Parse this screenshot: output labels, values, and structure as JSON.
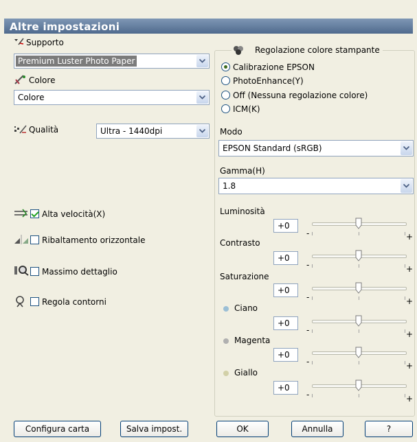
{
  "window": {
    "title": "Altre impostazioni"
  },
  "left": {
    "supporto_label": "Supporto",
    "supporto_value": "Premium Luster Photo Paper",
    "colore_label": "Colore",
    "colore_value": "Colore",
    "qualita_label": "Qualità",
    "qualita_value": "Ultra - 1440dpi",
    "alta_velocita_label": "Alta velocità(X)",
    "alta_velocita_checked": true,
    "ribaltamento_label": "Ribaltamento orizzontale",
    "ribaltamento_checked": false,
    "massimo_label": "Massimo dettaglio",
    "massimo_checked": false,
    "contorni_label": "Regola contorni",
    "contorni_checked": false
  },
  "color_group": {
    "title": "Regolazione colore stampante",
    "options": [
      {
        "label": "Calibrazione EPSON",
        "selected": true
      },
      {
        "label": "PhotoEnhance(Y)",
        "selected": false
      },
      {
        "label": "Off (Nessuna regolazione colore)",
        "selected": false
      },
      {
        "label": "ICM(K)",
        "selected": false
      }
    ],
    "modo_label": "Modo",
    "modo_value": "EPSON Standard (sRGB)",
    "gamma_label": "Gamma(H)",
    "gamma_value": "1.8"
  },
  "sliders": [
    {
      "label": "Luminosità",
      "value": "+0",
      "level": 0.5
    },
    {
      "label": "Contrasto",
      "value": "+0",
      "level": 0.5
    },
    {
      "label": "Saturazione",
      "value": "+0",
      "level": 0.5
    },
    {
      "label": "Ciano",
      "value": "+0",
      "level": 0.5,
      "dot_color": "#9bbfd6"
    },
    {
      "label": "Magenta",
      "value": "+0",
      "level": 0.5,
      "dot_color": "#b0b0b0"
    },
    {
      "label": "Giallo",
      "value": "+0",
      "level": 0.5,
      "dot_color": "#d2d0a8"
    }
  ],
  "slider_signs": {
    "minus": "-",
    "plus": "+"
  },
  "buttons": {
    "configura": "Configura carta",
    "salva": "Salva impost.",
    "ok": "OK",
    "annulla": "Annulla",
    "help": "?"
  },
  "icons": {
    "supporto": "paper-feed-icon",
    "colore": "color-brush-icon",
    "qualita": "quality-dots-icon",
    "alta_velocita": "high-speed-icon",
    "ribaltamento": "mirror-icon",
    "massimo": "detail-magnifier-icon",
    "contorni": "edge-smoothing-icon",
    "color_group": "color-circles-icon"
  }
}
